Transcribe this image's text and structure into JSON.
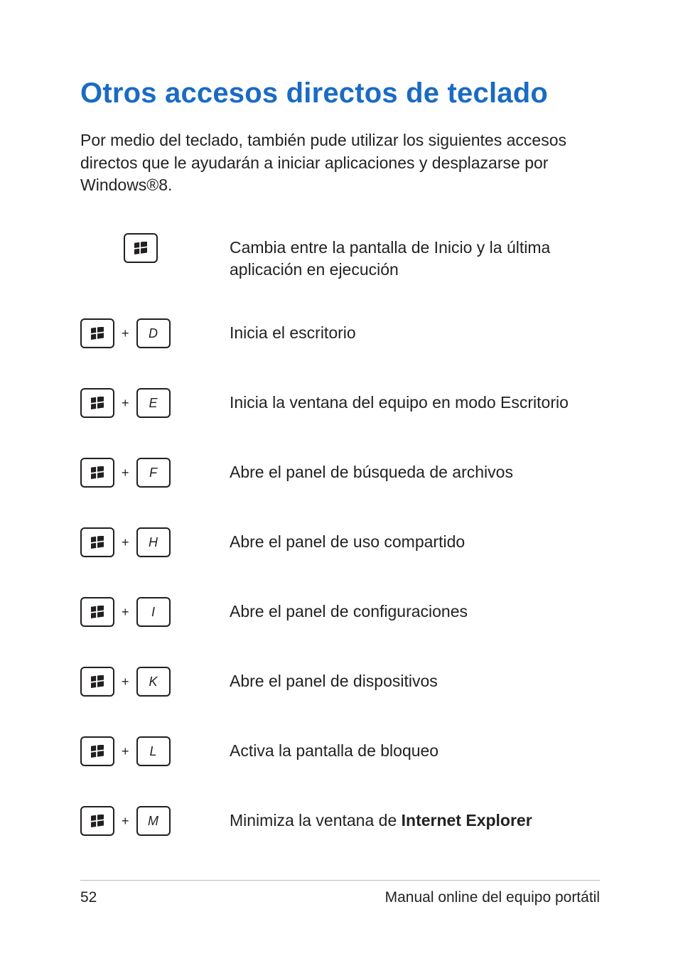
{
  "title": "Otros accesos directos de teclado",
  "intro": "Por medio del teclado, también pude utilizar los siguientes accesos directos que le ayudarán a iniciar aplicaciones y desplazarse por Windows®8.",
  "plus": "+",
  "shortcuts": [
    {
      "second_key": null,
      "desc_pre": "Cambia entre la pantalla de Inicio y la última aplicación en ejecución",
      "desc_bold": "",
      "desc_post": ""
    },
    {
      "second_key": "D",
      "desc_pre": "Inicia el escritorio",
      "desc_bold": "",
      "desc_post": ""
    },
    {
      "second_key": "E",
      "desc_pre": "Inicia la ventana del equipo en modo Escritorio",
      "desc_bold": "",
      "desc_post": ""
    },
    {
      "second_key": "F",
      "desc_pre": "Abre el panel de búsqueda de archivos",
      "desc_bold": "",
      "desc_post": ""
    },
    {
      "second_key": "H",
      "desc_pre": "Abre el panel de uso compartido",
      "desc_bold": "",
      "desc_post": ""
    },
    {
      "second_key": "I",
      "desc_pre": "Abre el panel de configuraciones",
      "desc_bold": "",
      "desc_post": ""
    },
    {
      "second_key": "K",
      "desc_pre": "Abre el panel de dispositivos",
      "desc_bold": "",
      "desc_post": ""
    },
    {
      "second_key": "L",
      "desc_pre": "Activa la pantalla de bloqueo",
      "desc_bold": "",
      "desc_post": ""
    },
    {
      "second_key": "M",
      "desc_pre": "Minimiza la ventana de ",
      "desc_bold": "Internet Explorer",
      "desc_post": ""
    }
  ],
  "footer": {
    "page_number": "52",
    "manual_title": "Manual online del equipo portátil"
  }
}
